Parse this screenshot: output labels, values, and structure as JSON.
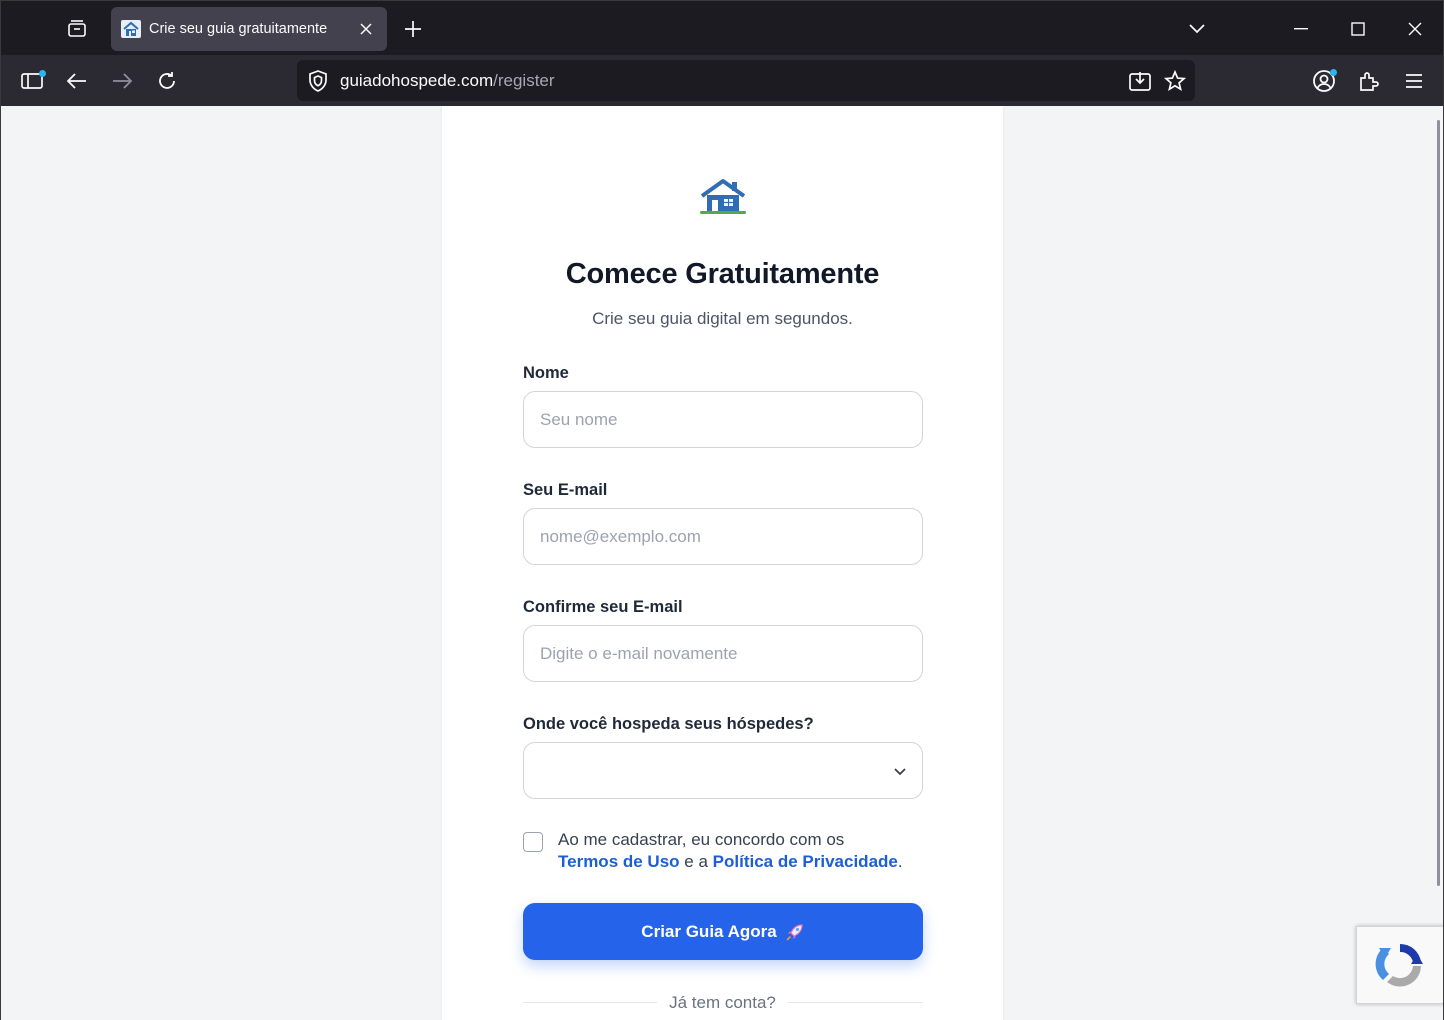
{
  "browser": {
    "tab_title": "Crie seu guia gratuitamente",
    "url_domain": "guiadohospede.com",
    "url_path": "/register"
  },
  "page": {
    "title": "Comece Gratuitamente",
    "subtitle": "Crie seu guia digital em segundos.",
    "fields": {
      "name": {
        "label": "Nome",
        "placeholder": "Seu nome",
        "value": ""
      },
      "email": {
        "label": "Seu E-mail",
        "placeholder": "nome@exemplo.com",
        "value": ""
      },
      "email_confirm": {
        "label": "Confirme seu E-mail",
        "placeholder": "Digite o e-mail novamente",
        "value": ""
      },
      "hosting": {
        "label": "Onde você hospeda seus hóspedes?",
        "selected": ""
      }
    },
    "terms": {
      "prefix": "Ao me cadastrar, eu concordo com os",
      "terms_link": "Termos de Uso",
      "joiner": "e a",
      "privacy_link": "Política de Privacidade",
      "suffix": ".",
      "checked": false
    },
    "cta_label": "Criar Guia Agora",
    "divider_text": "Já tem conta?"
  },
  "icons": {
    "logo": "house-icon",
    "cta": "rocket-icon"
  },
  "colors": {
    "accent": "#2563eb",
    "link": "#1d5ed6",
    "chrome_dark": "#1c1b22",
    "chrome_toolbar": "#2b2a33",
    "page_bg": "#f3f4f6"
  }
}
